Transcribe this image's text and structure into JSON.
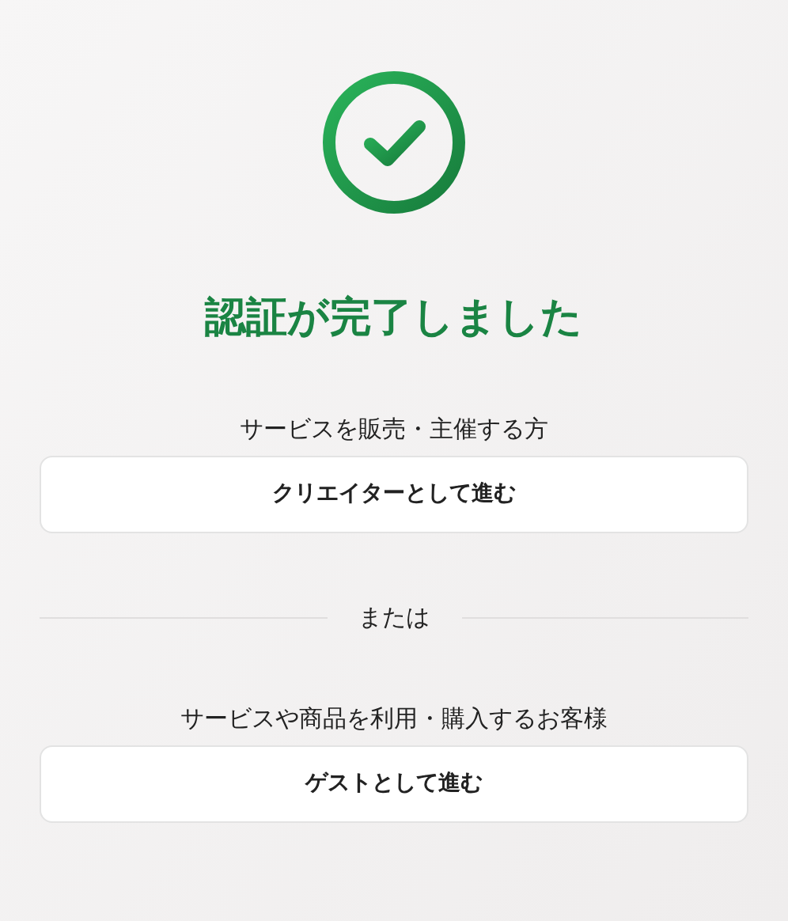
{
  "title": "認証が完了しました",
  "options": [
    {
      "label": "サービスを販売・主催する方",
      "button": "クリエイターとして進む"
    },
    {
      "label": "サービスや商品を利用・購入するお客様",
      "button": "ゲストとして進む"
    }
  ],
  "separator": "または"
}
